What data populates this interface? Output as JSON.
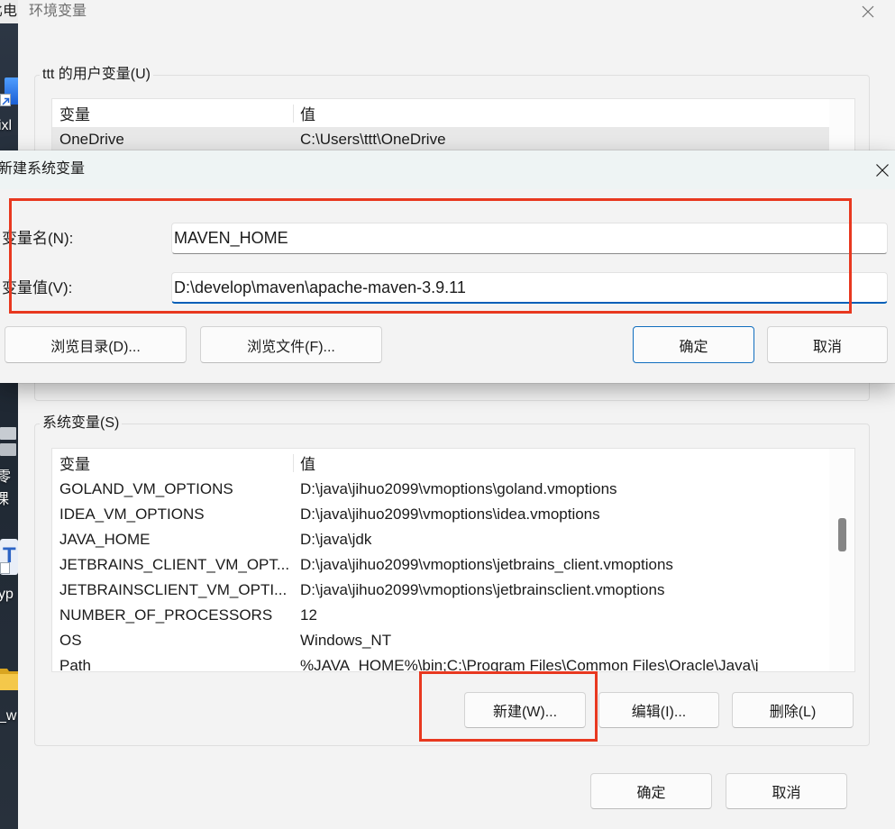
{
  "desktop": {
    "top_title": "比电",
    "shortcut_labels": [
      "ixl",
      "零",
      "课",
      "yp",
      "_w"
    ],
    "app_icon_letter": "T",
    "icons": [
      "app-shortcut-icon",
      "shortcut-arrow-icon",
      "document-icon",
      "folder-icon"
    ]
  },
  "env_window": {
    "title": "环境变量",
    "close_icon": "close-icon",
    "user_vars": {
      "group_label": "ttt 的用户变量(U)",
      "columns": [
        "变量",
        "值"
      ],
      "rows": [
        {
          "name": "OneDrive",
          "value": "C:\\Users\\ttt\\OneDrive",
          "selected": true
        }
      ]
    },
    "system_vars": {
      "group_label": "系统变量(S)",
      "columns": [
        "变量",
        "值"
      ],
      "rows": [
        {
          "name": "GOLAND_VM_OPTIONS",
          "value": "D:\\java\\jihuo2099\\vmoptions\\goland.vmoptions"
        },
        {
          "name": "IDEA_VM_OPTIONS",
          "value": "D:\\java\\jihuo2099\\vmoptions\\idea.vmoptions"
        },
        {
          "name": "JAVA_HOME",
          "value": "D:\\java\\jdk"
        },
        {
          "name": "JETBRAINS_CLIENT_VM_OPT...",
          "value": "D:\\java\\jihuo2099\\vmoptions\\jetbrains_client.vmoptions"
        },
        {
          "name": "JETBRAINSCLIENT_VM_OPTI...",
          "value": "D:\\java\\jihuo2099\\vmoptions\\jetbrainsclient.vmoptions"
        },
        {
          "name": "NUMBER_OF_PROCESSORS",
          "value": "12"
        },
        {
          "name": "OS",
          "value": "Windows_NT"
        },
        {
          "name": "Path",
          "value": "%JAVA_HOME%\\bin;C:\\Program Files\\Common Files\\Oracle\\Java\\j"
        }
      ],
      "buttons": {
        "new": "新建(W)...",
        "edit": "编辑(I)...",
        "delete": "删除(L)"
      }
    },
    "footer": {
      "ok": "确定",
      "cancel": "取消"
    }
  },
  "new_var_dialog": {
    "title": "新建系统变量",
    "close_icon": "close-icon",
    "variable_name": {
      "label": "变量名(N):",
      "value": "MAVEN_HOME"
    },
    "variable_value": {
      "label": "变量值(V):",
      "value": "D:\\develop\\maven\\apache-maven-3.9.11",
      "focused": true
    },
    "buttons": {
      "browse_dir": "浏览目录(D)...",
      "browse_file": "浏览文件(F)...",
      "ok": "确定",
      "cancel": "取消"
    }
  },
  "colors": {
    "annotation_red": "#e8381f",
    "accent_blue": "#0f6cbd",
    "focus_blue": "#005fb8",
    "window_bg": "#f3f3f3"
  }
}
